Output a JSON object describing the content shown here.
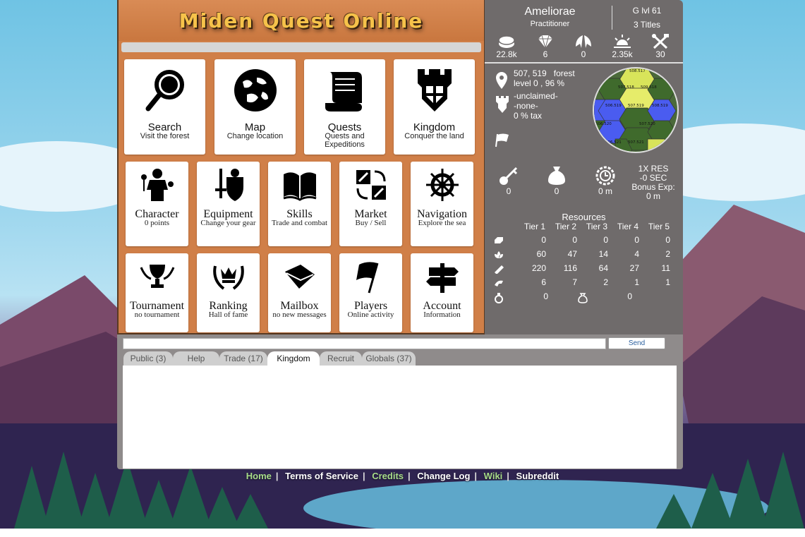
{
  "game": {
    "title": "Miden Quest Online"
  },
  "tiles_big": [
    {
      "title": "Search",
      "sub": "Visit the forest",
      "icon": "magnifier-icon"
    },
    {
      "title": "Map",
      "sub": "Change location",
      "icon": "globe-icon"
    },
    {
      "title": "Quests",
      "sub": "Quests and Expeditions",
      "icon": "scroll-icon"
    },
    {
      "title": "Kingdom",
      "sub": "Conquer the land",
      "icon": "castle-tower-icon"
    }
  ],
  "tiles_row2": [
    {
      "title": "Character",
      "sub": "0 points",
      "icon": "character-icon"
    },
    {
      "title": "Equipment",
      "sub": "Change your gear",
      "icon": "sword-shield-icon"
    },
    {
      "title": "Skills",
      "sub": "Trade and combat",
      "icon": "book-icon"
    },
    {
      "title": "Market",
      "sub": "Buy / Sell",
      "icon": "exchange-icon"
    },
    {
      "title": "Navigation",
      "sub": "Explore the sea",
      "icon": "ship-wheel-icon"
    }
  ],
  "tiles_row3": [
    {
      "title": "Tournament",
      "sub": "no tournament",
      "icon": "trophy-icon"
    },
    {
      "title": "Ranking",
      "sub": "Hall of fame",
      "icon": "laurel-crown-icon"
    },
    {
      "title": "Mailbox",
      "sub": "no new messages",
      "icon": "envelope-icon"
    },
    {
      "title": "Players",
      "sub": "Online activity",
      "icon": "flag-icon"
    },
    {
      "title": "Account",
      "sub": "Information",
      "icon": "signpost-icon"
    }
  ],
  "player": {
    "name": "Ameliorae",
    "rank": "Practitioner",
    "level": "G lvl 61",
    "titles": "3 Titles"
  },
  "stats": [
    {
      "icon": "coins-icon",
      "value": "22.8k"
    },
    {
      "icon": "diamond-icon",
      "value": "6"
    },
    {
      "icon": "feather-wings-icon",
      "value": "0"
    },
    {
      "icon": "sunrise-icon",
      "value": "2.35k"
    },
    {
      "icon": "crossed-tools-icon",
      "value": "30"
    }
  ],
  "location": {
    "coords": "507, 519",
    "terrain": "forest",
    "level": "level 0 , 96 %",
    "claim": "-unclaimed-",
    "owner": "-none-",
    "tax": "0 % tax"
  },
  "minimap": {
    "labels": [
      "508.517",
      "507.518",
      "509.518",
      "506.519",
      "507.519",
      "508.519",
      "506.520",
      "507.520",
      "506.521",
      "507.521"
    ]
  },
  "counters": [
    {
      "icon": "key-icon",
      "value": "0"
    },
    {
      "icon": "bag-icon",
      "value": "0"
    },
    {
      "icon": "clock-gear-icon",
      "value": "0 m"
    }
  ],
  "bonus": {
    "res": "1X RES",
    "sec": "-0 SEC",
    "exp_label": "Bonus Exp:",
    "exp": "0 m"
  },
  "resources": {
    "title": "Resources",
    "tiers": [
      "Tier 1",
      "Tier 2",
      "Tier 3",
      "Tier 4",
      "Tier 5"
    ],
    "rows": [
      {
        "icon": "ingot-icon",
        "values": [
          "0",
          "0",
          "0",
          "0",
          "0"
        ]
      },
      {
        "icon": "herb-icon",
        "values": [
          "60",
          "47",
          "14",
          "4",
          "2"
        ]
      },
      {
        "icon": "log-icon",
        "values": [
          "220",
          "116",
          "64",
          "27",
          "11"
        ]
      },
      {
        "icon": "leather-icon",
        "values": [
          "6",
          "7",
          "2",
          "1",
          "1"
        ]
      }
    ],
    "extra": [
      {
        "icon": "potion-icon",
        "value": "0"
      },
      {
        "icon": "gem-bag-icon",
        "value": "0"
      }
    ]
  },
  "chat": {
    "send_label": "Send",
    "tabs": [
      "Public (3)",
      "Help",
      "Trade (17)",
      "Kingdom",
      "Recruit",
      "Globals (37)"
    ],
    "active_tab": "Kingdom"
  },
  "footer": [
    "Home",
    "Terms of Service",
    "Credits",
    "Change Log",
    "Wiki",
    "Subreddit"
  ],
  "colors": {
    "panel_orange": "#d07f48",
    "panel_grey": "#6f6b6b",
    "title_gold": "#f6c24a",
    "footer_green": "#a8dd8a"
  }
}
